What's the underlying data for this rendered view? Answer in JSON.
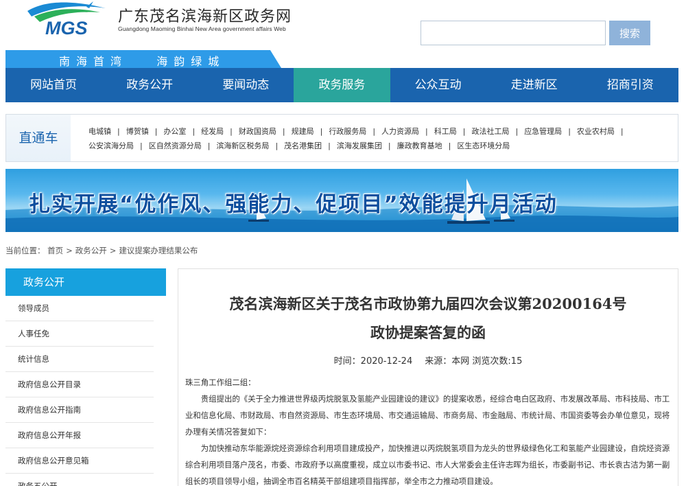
{
  "header": {
    "logo_text": "MGS",
    "site_title": "广东茂名滨海新区政务网",
    "site_subtitle": "Guangdong Maoming Binhai New Area government affairs Web",
    "search_placeholder": "",
    "search_button": "搜索"
  },
  "slogan": "南海首湾   海韵绿城",
  "nav": {
    "items": [
      "网站首页",
      "政务公开",
      "要闻动态",
      "政务服务",
      "公众互动",
      "走进新区",
      "招商引资"
    ],
    "active_index": 3
  },
  "direct": {
    "label": "直通车",
    "links": [
      "电城镇",
      "博贺镇",
      "办公室",
      "经发局",
      "财政国资局",
      "规建局",
      "行政服务局",
      "人力资源局",
      "科工局",
      "政法社工局",
      "应急管理局",
      "农业农村局",
      "公安滨海分局",
      "区自然资源分局",
      "滨海新区税务局",
      "茂名港集团",
      "滨海发展集团",
      "廉政教育基地",
      "区生态环境分局"
    ]
  },
  "banner": {
    "text": "扎实开展“优作风、强能力、促项目”效能提升月活动"
  },
  "breadcrumb": {
    "prefix": "当前位置：",
    "items": [
      "首页",
      "政务公开",
      "建议提案办理结果公布"
    ]
  },
  "sidebar": {
    "title": "政务公开",
    "items": [
      "领导成员",
      "人事任免",
      "统计信息",
      "政府信息公开目录",
      "政府信息公开指南",
      "政府信息公开年报",
      "政府信息公开意见箱",
      "政务五公开"
    ]
  },
  "article": {
    "title_line1": "茂名滨海新区关于茂名市政协第九届四次会议第20200164号",
    "title_line2": "政协提案答复的函",
    "time_label": "时间：",
    "time": "2020-12-24",
    "source_label": "来源：",
    "source": "本网",
    "views_label": "浏览次数:",
    "views": "15",
    "salutation": "珠三角工作组二组：",
    "para1": "贵组提出的《关于全力推进世界级丙烷脱氢及氢能产业园建设的建议》的提案收悉，经综合电白区政府、市发展改革局、市科技局、市工业和信息化局、市财政局、市自然资源局、市生态环境局、市交通运输局、市商务局、市金融局、市统计局、市国资委等会办单位意见，现将办理有关情况答复如下：",
    "para2": "为加快推动东华能源烷烃资源综合利用项目建成投产，加快推进以丙烷脱氢项目为龙头的世界级绿色化工和氢能产业园建设，自烷烃资源综合利用项目落户茂名，市委、市政府予以高度重视，成立以市委书记、市人大常委会主任许志晖为组长，市委副书记、市长袁古洁为第一副组长的项目领导小组，抽调全市百名精英干部组建项目指挥部，举全市之力推动项目建设。"
  },
  "colors": {
    "nav_bg": "#1a64ae",
    "nav_active": "#2aa59c",
    "sidebar_title_bg": "#17a1de",
    "search_btn": "#8fb3da",
    "slogan_bg": "#2e9be8"
  }
}
